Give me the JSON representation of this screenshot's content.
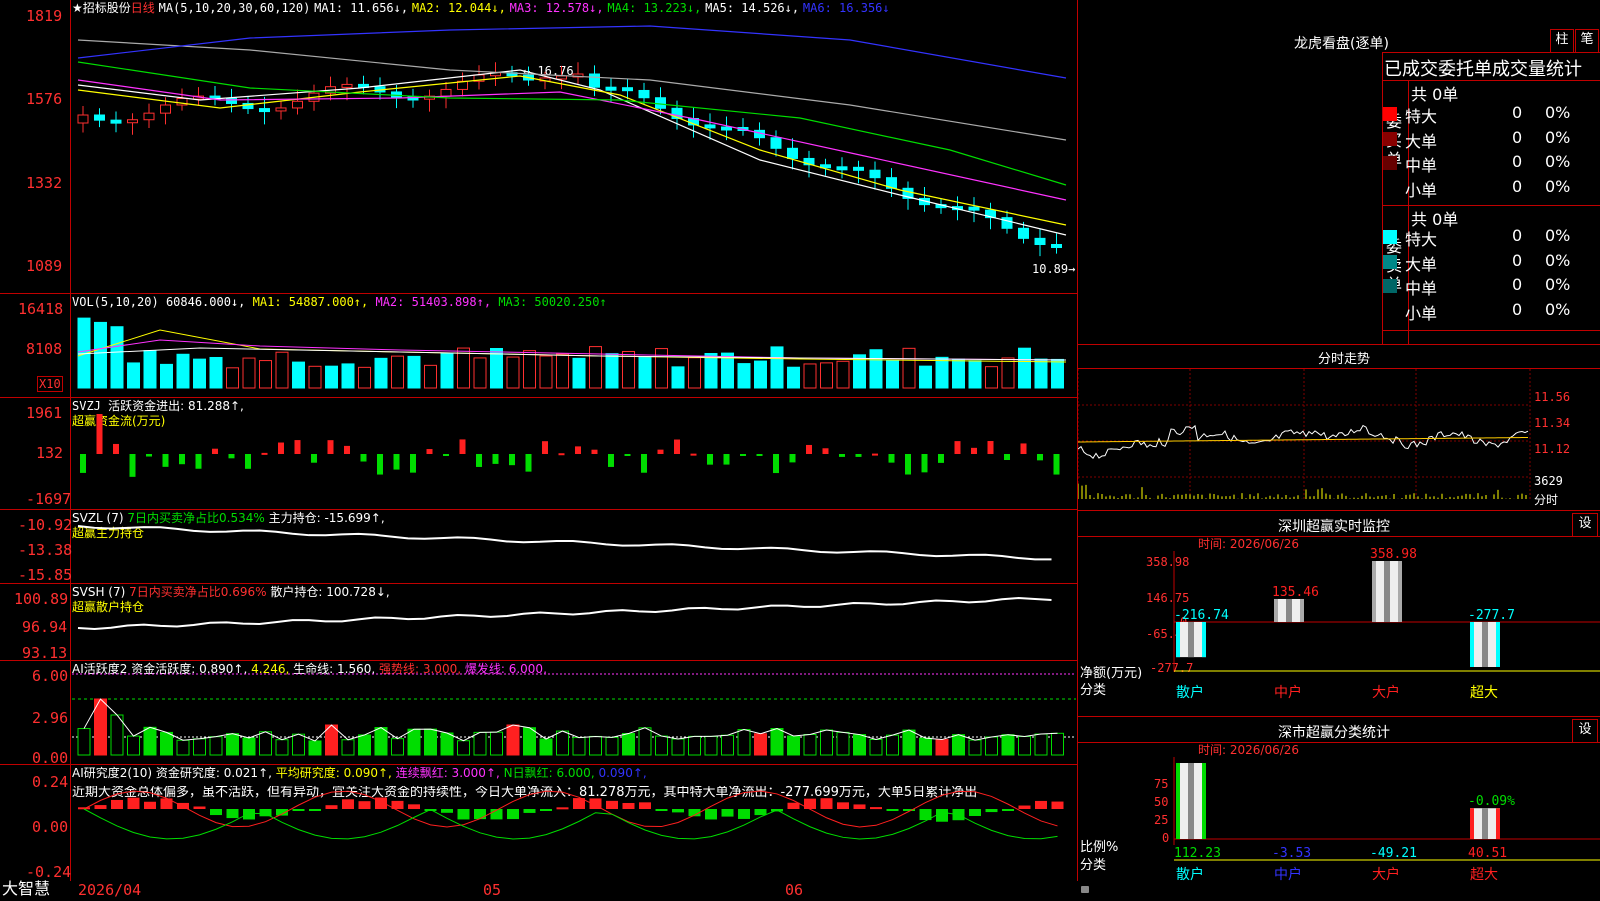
{
  "main_chart": {
    "star": "★",
    "stock_name": "招标股份",
    "period": "日线",
    "ma_label": "MA(5,10,20,30,60,120)",
    "ma1": "MA1: 11.656↓,",
    "ma2": "MA2: 12.044↓,",
    "ma3": "MA3: 12.578↓,",
    "ma4": "MA4: 13.223↓,",
    "ma5": "MA5: 14.526↓,",
    "ma6": "MA6: 16.356↓",
    "y_ticks": [
      "1819",
      "1576",
      "1332",
      "1089"
    ],
    "high_mark": "16.76",
    "low_mark": "10.89",
    "colors": {
      "up": "#ff3030",
      "down": "#00ffff",
      "ma1": "#ffffff",
      "ma2": "#ffff00",
      "ma3": "#ff33ff",
      "ma4": "#00dd00",
      "ma5": "#aaaaaa",
      "ma6": "#3333ff"
    }
  },
  "vol_panel": {
    "label": "VOL(5,10,20)",
    "value": "60846.000↓,",
    "ma1": "MA1: 54887.000↑,",
    "ma2": "MA2: 51403.898↑,",
    "ma3": "MA3: 50020.250↑",
    "y_ticks": [
      "16418",
      "8108"
    ],
    "unit": "X10"
  },
  "svzj_panel": {
    "label": "SVZJ",
    "desc": "活跃资金进出: 81.288↑,",
    "sub": "超赢资金流(万元)",
    "y_ticks": [
      "1961",
      "132",
      "-1697"
    ]
  },
  "svzl_panel": {
    "label": "SVZL (7)",
    "net": "7日内买卖净占比0.534%",
    "hold": "主力持仓: -15.699↑,",
    "sub": "超赢主力持仓",
    "y_ticks": [
      "-10.92",
      "-13.38",
      "-15.85"
    ]
  },
  "svsh_panel": {
    "label": "SVSH (7)",
    "net": "7日内买卖净占比0.696%",
    "hold": "散户持仓: 100.728↓,",
    "sub": "超赢散户持仓",
    "y_ticks": [
      "100.89",
      "96.94",
      "93.13"
    ]
  },
  "ai_active_panel": {
    "label": "AI活跃度2",
    "a": "资金活跃度: 0.890↑,",
    "b": "4.246,",
    "c": "生命线: 1.560,",
    "d": "强势线: 3.000,",
    "e": "爆发线: 6.000,",
    "y_ticks": [
      "6.00",
      "2.96",
      "0.00"
    ]
  },
  "ai_research_panel": {
    "label": "AI研究度2(10)",
    "a": "资金研究度: 0.021↑,",
    "b": "平均研究度: 0.090↑,",
    "c": "连续飘红: 3.000↑,",
    "d": "N日飘红: 6.000,",
    "e": "0.090↑,",
    "comment": "近期大资金总体偏多，虽不活跃，但有异动，宜关注大资金的持续性，今日大单净流入：81.278万元，其中特大单净流出：-277.699万元，大单5日累计净出",
    "y_ticks": [
      "0.24",
      "0.00",
      "-0.24"
    ]
  },
  "bottom_axis": {
    "app_name": "大智慧",
    "dates": [
      "2026/04",
      "05",
      "06"
    ]
  },
  "dragon_panel": {
    "title": "龙虎看盘(逐单)",
    "btn_bar": "柱",
    "btn_pen": "笔",
    "header": "已成交委托单成交量统计",
    "buy_label": "委买单",
    "sell_label": "委卖单",
    "buy_total": "共 0单",
    "sell_total": "共 0单",
    "buy_rows": [
      {
        "name": "特大",
        "count": "0",
        "pct": "0%",
        "color": "#ff0000"
      },
      {
        "name": "大单",
        "count": "0",
        "pct": "0%",
        "color": "#880000"
      },
      {
        "name": "中单",
        "count": "0",
        "pct": "0%",
        "color": "#660000"
      },
      {
        "name": "小单",
        "count": "0",
        "pct": "0%",
        "color": "#000000"
      }
    ],
    "sell_rows": [
      {
        "name": "特大",
        "count": "0",
        "pct": "0%",
        "color": "#00ffff"
      },
      {
        "name": "大单",
        "count": "0",
        "pct": "0%",
        "color": "#008888"
      },
      {
        "name": "中单",
        "count": "0",
        "pct": "0%",
        "color": "#006666"
      },
      {
        "name": "小单",
        "count": "0",
        "pct": "0%",
        "color": "#000000"
      }
    ]
  },
  "intraday_panel": {
    "title": "分时走势",
    "y_ticks": [
      "11.56",
      "11.34",
      "11.12"
    ],
    "vol": "3629",
    "vol_label": "分时"
  },
  "monitor_panel": {
    "title": "深圳超赢实时监控",
    "btn": "设",
    "time": "时间: 2026/06/26",
    "y_ticks": [
      "358.98",
      "146.75",
      "0",
      "-65.47",
      "-277.7"
    ],
    "unit": "净额(万元)",
    "cat_label": "分类",
    "chart_data": {
      "type": "bar",
      "categories": [
        "散户",
        "中户",
        "大户",
        "超大"
      ],
      "values": [
        -216.74,
        135.46,
        358.98,
        -277.7
      ],
      "labels": [
        "-216.74",
        "135.46",
        "358.98",
        "-277.7"
      ],
      "ylabel": "净额(万元)",
      "ylim": [
        -277.7,
        358.98
      ]
    }
  },
  "classify_panel": {
    "title": "深市超赢分类统计",
    "btn": "设",
    "time": "时间: 2026/06/26",
    "y_ticks": [
      "75",
      "50",
      "25",
      "0"
    ],
    "unit": "比例%",
    "cat_label": "分类",
    "chart_data": {
      "type": "bar",
      "categories": [
        "散户",
        "中户",
        "大户",
        "超大"
      ],
      "values": [
        112.23,
        -3.53,
        -49.21,
        40.51
      ],
      "labels": [
        "112.23",
        "-3.53",
        "-49.21",
        "40.51"
      ],
      "extra_label": "-0.09%",
      "ylabel": "比例%",
      "ylim": [
        0,
        100
      ]
    }
  }
}
